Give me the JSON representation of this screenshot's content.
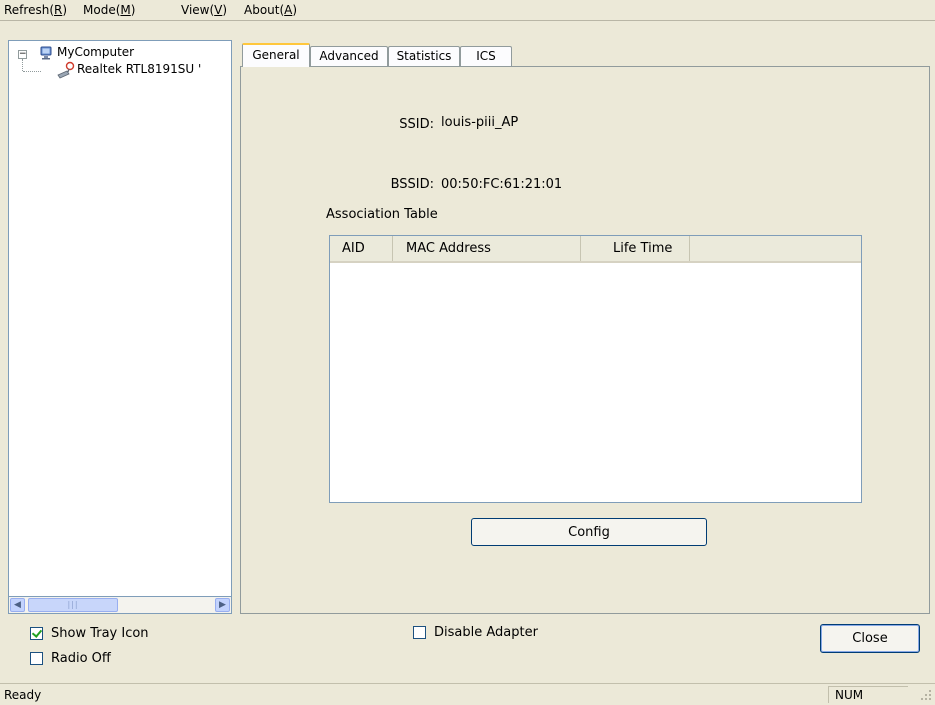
{
  "menubar": {
    "items": [
      {
        "label": "Refresh",
        "mnemonic": "R"
      },
      {
        "label": "Mode",
        "mnemonic": "M"
      },
      {
        "label": "View",
        "mnemonic": "V"
      },
      {
        "label": "About",
        "mnemonic": "A"
      }
    ]
  },
  "tree": {
    "root": {
      "label": "MyComputer",
      "icon": "computer-icon"
    },
    "adapter": {
      "label": "Realtek RTL8191SU '",
      "icon": "wireless-adapter-icon"
    }
  },
  "tabs": [
    {
      "label": "General",
      "active": true
    },
    {
      "label": "Advanced"
    },
    {
      "label": "Statistics"
    },
    {
      "label": "ICS"
    }
  ],
  "general": {
    "ssid_label": "SSID:",
    "ssid_value": "louis-piii_AP",
    "bssid_label": "BSSID:",
    "bssid_value": "00:50:FC:61:21:01",
    "association_table_label": "Association Table",
    "columns": [
      "AID",
      "MAC Address",
      "Life Time"
    ],
    "config_label": "Config"
  },
  "options": {
    "show_tray_icon": {
      "label": "Show Tray Icon",
      "checked": true
    },
    "radio_off": {
      "label": "Radio Off",
      "checked": false
    },
    "disable_adapter": {
      "label": "Disable Adapter",
      "checked": false
    }
  },
  "close_label": "Close",
  "statusbar": {
    "status": "Ready",
    "num": "NUM"
  },
  "colors": {
    "active_tab_accent": "#ffc73c",
    "checkmark": "#21a121",
    "button_border": "#003c74"
  }
}
